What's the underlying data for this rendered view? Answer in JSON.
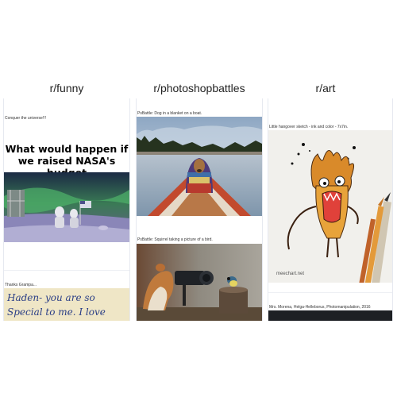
{
  "columns": [
    {
      "title": "r/funny",
      "posts": [
        {
          "caption": "Conquer the universe!!!",
          "meme_text": "What would happen if we raised NASA's budget"
        },
        {
          "caption": "Thanks Grampa...",
          "note_lines": [
            "Haden- you are so",
            "Special to me. I love"
          ]
        }
      ]
    },
    {
      "title": "r/photoshopbattles",
      "posts": [
        {
          "caption": "PsBattle: Dog in a blanket on a boat."
        },
        {
          "caption": "PsBattle: Squirrel taking a picture of a bird."
        }
      ]
    },
    {
      "title": "r/art",
      "posts": [
        {
          "caption": "Little hangover sketch - ink and color - 7x7in.",
          "watermark": "meechart.net"
        },
        {
          "caption": "Mrs. Morena, Helga-Helleborus, Photomanipulation, 2016"
        }
      ]
    }
  ],
  "colors": {
    "background": "#ffffff",
    "column_border": "#e6e9f0",
    "title_text": "#222222"
  }
}
